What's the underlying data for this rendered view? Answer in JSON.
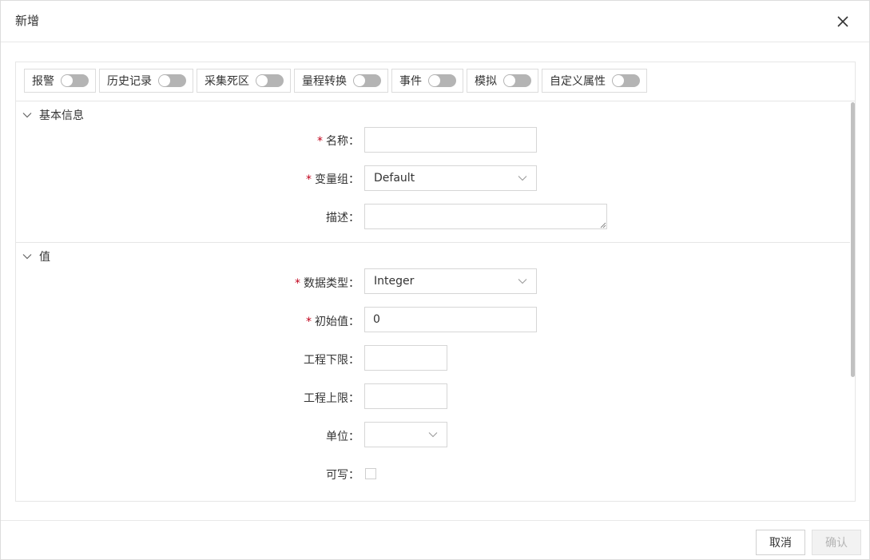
{
  "dialog": {
    "title": "新增",
    "close_icon": "close-icon"
  },
  "toggles": [
    {
      "label": "报警",
      "on": false
    },
    {
      "label": "历史记录",
      "on": false
    },
    {
      "label": "采集死区",
      "on": false
    },
    {
      "label": "量程转换",
      "on": false
    },
    {
      "label": "事件",
      "on": false
    },
    {
      "label": "模拟",
      "on": false
    },
    {
      "label": "自定义属性",
      "on": false
    }
  ],
  "basic_info": {
    "title": "基本信息",
    "name_label": "名称：",
    "name_value": "",
    "group_label": "变量组：",
    "group_value": "Default",
    "desc_label": "描述：",
    "desc_value": ""
  },
  "value_section": {
    "title": "值",
    "datatype_label": "数据类型：",
    "datatype_value": "Integer",
    "initial_label": "初始值：",
    "initial_value": "0",
    "eng_low_label": "工程下限：",
    "eng_low_value": "",
    "eng_high_label": "工程上限：",
    "eng_high_value": "",
    "unit_label": "单位：",
    "unit_value": "",
    "writable_label": "可写：",
    "writable_checked": false
  },
  "required_mark": "*",
  "footer": {
    "cancel_label": "取消",
    "confirm_label": "确认"
  },
  "colors": {
    "required": "#c0001a",
    "switch_off": "#b4b4b4",
    "border": "#d6d6d6"
  }
}
